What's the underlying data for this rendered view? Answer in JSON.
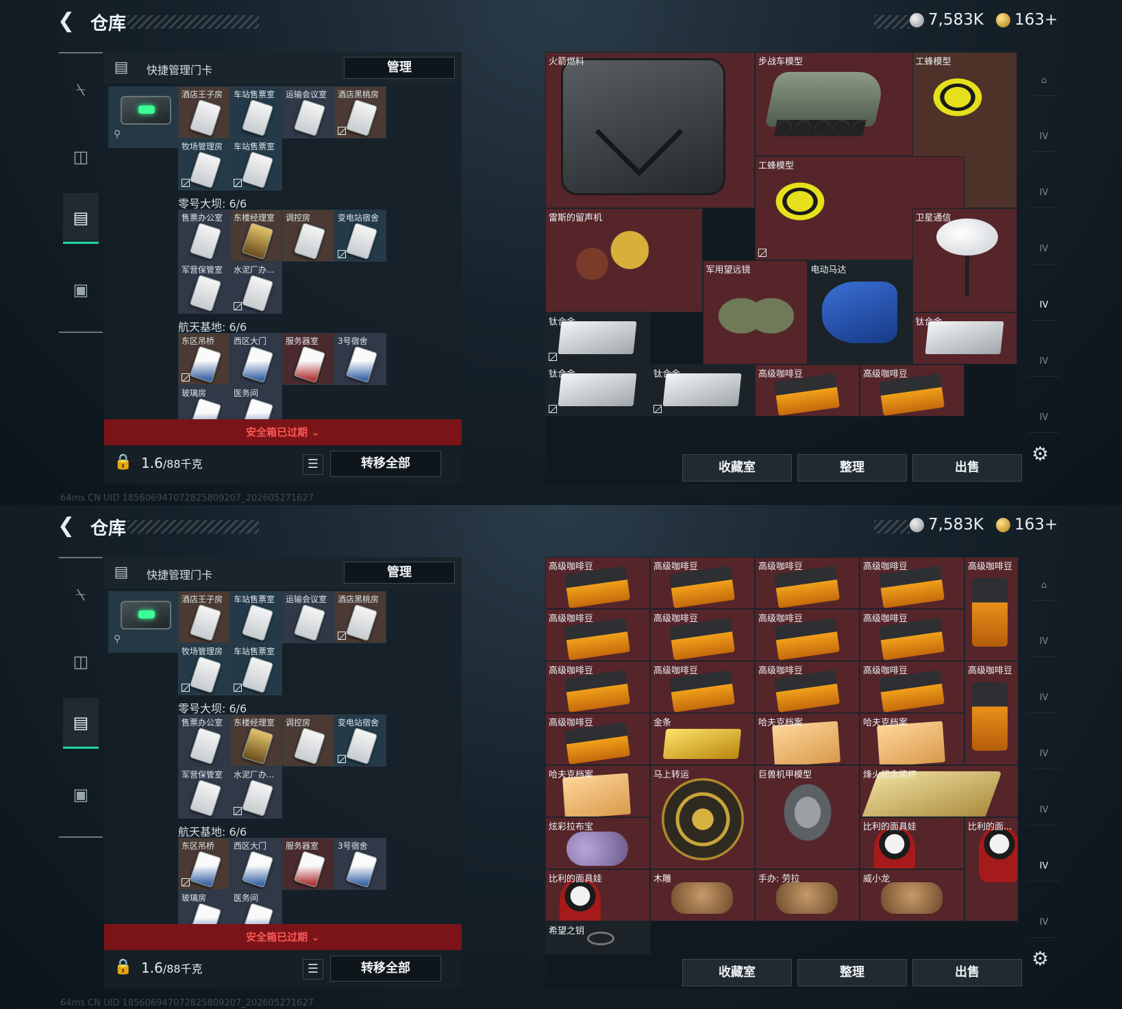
{
  "window_title": "仓库",
  "currency": {
    "silver": "7,583K",
    "gold": "163+"
  },
  "left_panel": {
    "header_title": "快捷管理门卡",
    "manage_label": "管理",
    "groups": [
      {
        "title": "",
        "cells": [
          {
            "label": "酒店王子房",
            "tint": "brown",
            "card": "white"
          },
          {
            "label": "车站售票室",
            "tint": "teal",
            "card": "white"
          },
          {
            "label": "运输会议室",
            "tint": "slate",
            "card": "white"
          },
          {
            "label": "酒店黑桃房",
            "tint": "brown",
            "card": "white",
            "mark": true
          },
          {
            "label": "牧场管理房",
            "tint": "teal",
            "card": "white",
            "mark": true
          },
          {
            "label": "车站售票室",
            "tint": "teal",
            "card": "white",
            "mark": true
          }
        ]
      },
      {
        "title": "零号大坝: 6/6",
        "cells": [
          {
            "label": "售票办公室",
            "tint": "slate",
            "card": "white"
          },
          {
            "label": "东楼经理室",
            "tint": "brown",
            "card": "gold"
          },
          {
            "label": "调控房",
            "tint": "brown",
            "card": "white"
          },
          {
            "label": "变电站宿舍",
            "tint": "teal",
            "card": "white",
            "mark": true
          },
          {
            "label": "军营保管室",
            "tint": "slate",
            "card": "white"
          },
          {
            "label": "水泥厂办...",
            "tint": "slate",
            "card": "white",
            "mark": true
          }
        ]
      },
      {
        "title": "航天基地: 6/6",
        "cells": [
          {
            "label": "东区吊桥",
            "tint": "brown",
            "card": "blue",
            "mark": true
          },
          {
            "label": "西区大门",
            "tint": "slate",
            "card": "blue"
          },
          {
            "label": "服务器室",
            "tint": "red",
            "card": "red"
          },
          {
            "label": "3号宿舍",
            "tint": "slate",
            "card": "blue"
          },
          {
            "label": "玻璃房",
            "tint": "slate",
            "card": "blue"
          },
          {
            "label": "医务间",
            "tint": "slate",
            "card": "blue"
          }
        ]
      }
    ],
    "expired_label": "安全箱已过期",
    "weight_current": "1.6",
    "weight_max": "/88千克",
    "transfer_label": "转移全部"
  },
  "status_text": "64ms    CN UID 185606947072825809207_202605271627",
  "right_panel": {
    "buttons": [
      "收藏室",
      "整理",
      "出售"
    ]
  },
  "screens": [
    {
      "items": [
        {
          "label": "火箭燃料",
          "bg": "red",
          "art": "can"
        },
        {
          "label": "步战车模型",
          "bg": "red",
          "art": "vehicle"
        },
        {
          "label": "工蜂模型",
          "bg": "brown",
          "art": "wasp"
        },
        {
          "label": "工蜂模型",
          "bg": "red",
          "art": "wasp"
        },
        {
          "label": "雷斯的留声机",
          "bg": "red",
          "art": "gramo"
        },
        {
          "label": "卫星通信",
          "bg": "red",
          "art": "dish"
        },
        {
          "label": "军用望远镜",
          "bg": "red",
          "art": "bino"
        },
        {
          "label": "电动马达",
          "bg": "dark",
          "art": "motor"
        },
        {
          "label": "钛合金",
          "bg": "dark",
          "art": "plate"
        },
        {
          "label": "钛合金",
          "bg": "red",
          "art": "plate"
        },
        {
          "label": "钛合金",
          "bg": "dark",
          "art": "plate"
        },
        {
          "label": "钛合金",
          "bg": "dark",
          "art": "plate"
        },
        {
          "label": "高级咖啡豆",
          "bg": "red",
          "art": "bean"
        },
        {
          "label": "高级咖啡豆",
          "bg": "red",
          "art": "bean"
        }
      ]
    },
    {
      "items": [
        {
          "label": "高级咖啡豆",
          "bg": "red",
          "art": "bean"
        },
        {
          "label": "高级咖啡豆",
          "bg": "red",
          "art": "bean"
        },
        {
          "label": "高级咖啡豆",
          "bg": "red",
          "art": "bean"
        },
        {
          "label": "高级咖啡豆",
          "bg": "red",
          "art": "bean"
        },
        {
          "label": "高级咖啡豆",
          "bg": "red",
          "art": "bag"
        },
        {
          "label": "高级咖啡豆",
          "bg": "red",
          "art": "bean"
        },
        {
          "label": "高级咖啡豆",
          "bg": "red",
          "art": "bean"
        },
        {
          "label": "高级咖啡豆",
          "bg": "red",
          "art": "bean"
        },
        {
          "label": "高级咖啡豆",
          "bg": "red",
          "art": "bean"
        },
        {
          "label": "高级咖啡豆",
          "bg": "red",
          "art": "bean"
        },
        {
          "label": "高级咖啡豆",
          "bg": "red",
          "art": "bean"
        },
        {
          "label": "高级咖啡豆",
          "bg": "red",
          "art": "bean"
        },
        {
          "label": "高级咖啡豆",
          "bg": "red",
          "art": "bean"
        },
        {
          "label": "高级咖啡豆",
          "bg": "red",
          "art": "bag"
        },
        {
          "label": "高级咖啡豆",
          "bg": "red",
          "art": "bean"
        },
        {
          "label": "金条",
          "bg": "red",
          "art": "goldbar"
        },
        {
          "label": "哈夫克档案",
          "bg": "red",
          "art": "file"
        },
        {
          "label": "哈夫克档案",
          "bg": "red",
          "art": "file"
        },
        {
          "label": "哈夫克档案",
          "bg": "red",
          "art": "file"
        },
        {
          "label": "马上转运",
          "bg": "red",
          "art": "disc"
        },
        {
          "label": "巨兽机甲模型",
          "bg": "red",
          "art": "mecha"
        },
        {
          "label": "烽火纪念奖杯",
          "bg": "red",
          "art": "trophy"
        },
        {
          "label": "炫彩拉布宝",
          "bg": "red",
          "art": "bear"
        },
        {
          "label": "比利的面具娃",
          "bg": "red",
          "art": "doll"
        },
        {
          "label": "比利的面...",
          "bg": "red",
          "art": "doll"
        },
        {
          "label": "比利的面具娃",
          "bg": "red",
          "art": "doll"
        },
        {
          "label": "木雕",
          "bg": "red",
          "art": "fig"
        },
        {
          "label": "手办: 劳拉",
          "bg": "red",
          "art": "fig"
        },
        {
          "label": "威小龙",
          "bg": "red",
          "art": "fig"
        },
        {
          "label": "希望之钥",
          "bg": "dark",
          "art": "key"
        }
      ]
    }
  ],
  "right_tab_icons": [
    "vault-icon",
    "armory-icon",
    "rig-icon",
    "gear-icon-2",
    "backpack-icon",
    "collection-icon",
    "misc-icon"
  ],
  "tab_tier_label": "IV",
  "colors": {
    "accent": "#23d6a0",
    "expired_bg": "#7a1418",
    "expired_text": "#ff5655",
    "slot_red": "#55252a"
  }
}
